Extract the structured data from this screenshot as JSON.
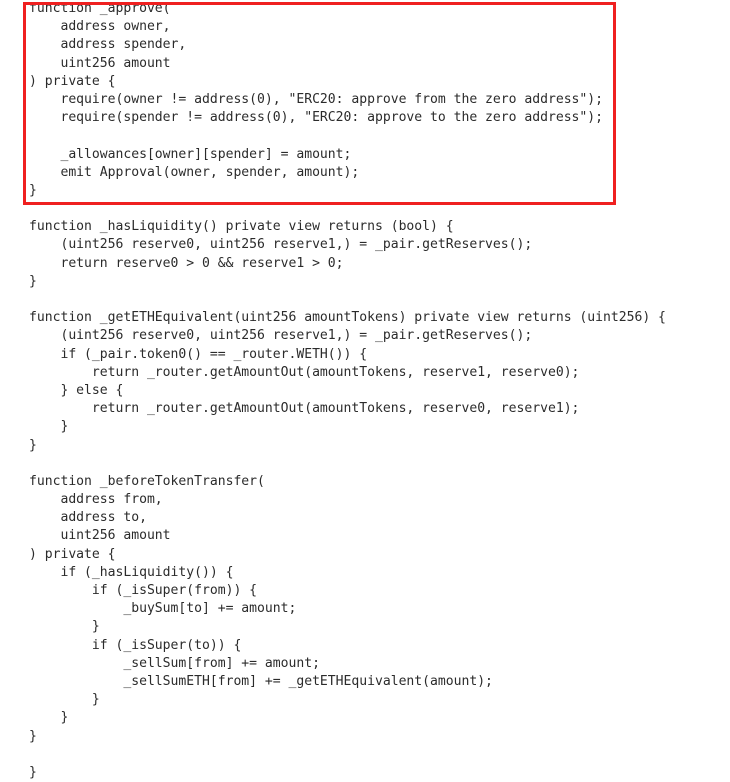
{
  "viewer": {
    "name": "code-snippet-viewer",
    "language": "solidity",
    "background_color": "#ffffff",
    "text_color": "#2b2b2b",
    "font_size_px": 13,
    "line_height_px": 18,
    "tab_size_spaces": 4
  },
  "annotation": {
    "type": "rectangle-highlight",
    "color": "#ef2020",
    "border_width_px": 3,
    "target_function": "_approve",
    "covers_lines": [
      1,
      11
    ]
  },
  "code": {
    "lines": [
      "function _approve(",
      "    address owner,",
      "    address spender,",
      "    uint256 amount",
      ") private {",
      "    require(owner != address(0), \"ERC20: approve from the zero address\");",
      "    require(spender != address(0), \"ERC20: approve to the zero address\");",
      "",
      "    _allowances[owner][spender] = amount;",
      "    emit Approval(owner, spender, amount);",
      "}",
      "",
      "function _hasLiquidity() private view returns (bool) {",
      "    (uint256 reserve0, uint256 reserve1,) = _pair.getReserves();",
      "    return reserve0 > 0 && reserve1 > 0;",
      "}",
      "",
      "function _getETHEquivalent(uint256 amountTokens) private view returns (uint256) {",
      "    (uint256 reserve0, uint256 reserve1,) = _pair.getReserves();",
      "    if (_pair.token0() == _router.WETH()) {",
      "        return _router.getAmountOut(amountTokens, reserve1, reserve0);",
      "    } else {",
      "        return _router.getAmountOut(amountTokens, reserve0, reserve1);",
      "    }",
      "}",
      "",
      "function _beforeTokenTransfer(",
      "    address from,",
      "    address to,",
      "    uint256 amount",
      ") private {",
      "    if (_hasLiquidity()) {",
      "        if (_isSuper(from)) {",
      "            _buySum[to] += amount;",
      "        }",
      "        if (_isSuper(to)) {",
      "            _sellSum[from] += amount;",
      "            _sellSumETH[from] += _getETHEquivalent(amount);",
      "        }",
      "    }",
      "}",
      "",
      "}"
    ]
  }
}
